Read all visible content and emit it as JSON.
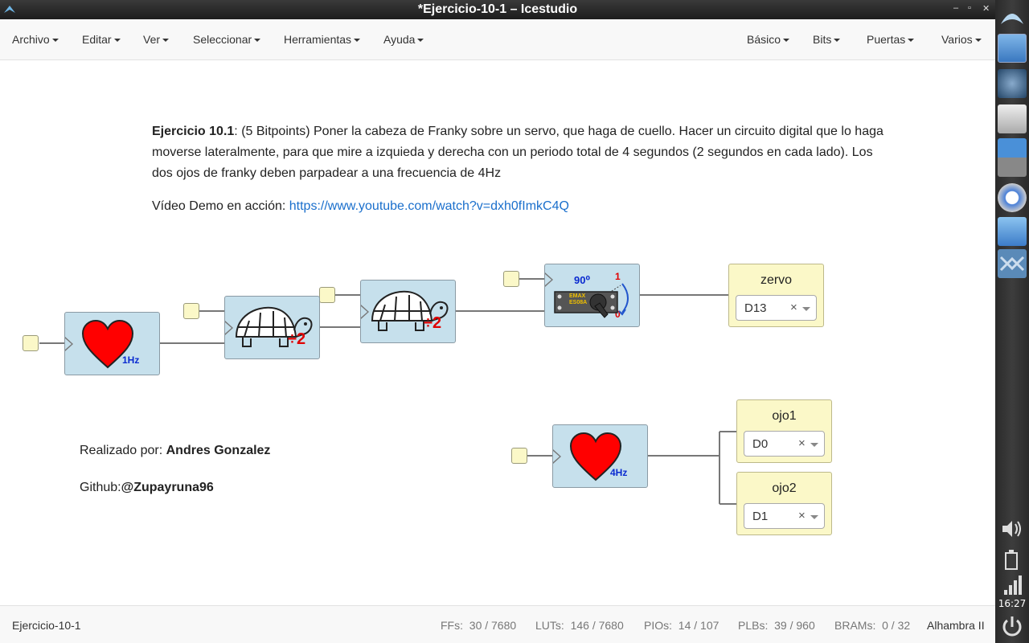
{
  "window": {
    "title": "*Ejercicio-10-1 – Icestudio",
    "minimize": "‒",
    "restore": "▫",
    "close": "✕"
  },
  "menubar": {
    "left": [
      "Archivo",
      "Editar",
      "Ver",
      "Seleccionar",
      "Herramientas",
      "Ayuda"
    ],
    "right": [
      "Básico",
      "Bits",
      "Puertas",
      "Varios"
    ]
  },
  "description": {
    "bold": "Ejercicio 10.1",
    "text": ": (5 Bitpoints) Poner la cabeza de Franky sobre un servo, que haga de cuello. Hacer un circuito digital que lo haga moverse lateralmente, para que mire a izquieda y derecha con un periodo total de 4 segundos (2 segundos en cada lado). Los dos ojos de franky deben parpadear a una frecuencia de 4Hz",
    "video_label": "Vídeo Demo en acción: ",
    "video_link": "https://www.youtube.com/watch?v=dxh0fImkC4Q"
  },
  "credits": {
    "made_by_label": "Realizado por: ",
    "made_by_name": "Andres Gonzalez",
    "github_label": "Github:",
    "github_handle": "@Zupayruna96"
  },
  "blocks": {
    "heart1": {
      "label": "1Hz"
    },
    "div1": {
      "label": "÷2"
    },
    "div2": {
      "label": "÷2"
    },
    "servo": {
      "angle": "90⁰",
      "model_line1": "EMAX",
      "model_line2": "ES08A",
      "pos1": "1",
      "pos0": "0"
    },
    "heart4": {
      "label": "4Hz"
    }
  },
  "outputs": {
    "zervo": {
      "name": "zervo",
      "pin": "D13"
    },
    "ojo1": {
      "name": "ojo1",
      "pin": "D0"
    },
    "ojo2": {
      "name": "ojo2",
      "pin": "D1"
    }
  },
  "status": {
    "project": "Ejercicio-10-1",
    "ffs_label": "FFs:",
    "ffs": "30 / 7680",
    "luts_label": "LUTs:",
    "luts": "146 / 7680",
    "pios_label": "PIOs:",
    "pios": "14 / 107",
    "plbs_label": "PLBs:",
    "plbs": "39 / 960",
    "brams_label": "BRAMs:",
    "brams": "0 / 32",
    "board": "Alhambra II"
  },
  "clock": "16:27",
  "colors": {
    "block": "#c6e0ec",
    "port": "#fbf8c8",
    "link": "#1a6fcc",
    "heart": "#ff0000"
  }
}
